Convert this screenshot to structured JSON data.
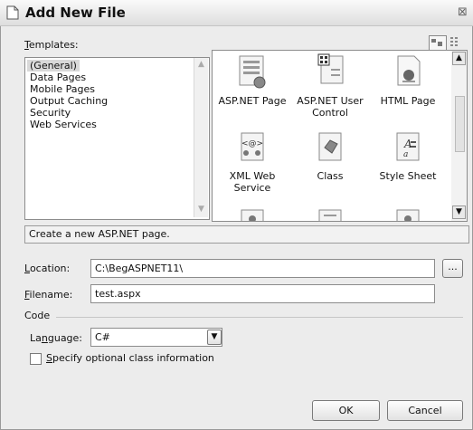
{
  "window": {
    "title": "Add New File",
    "close_glyph": "⊠"
  },
  "templates": {
    "label": "Templates:",
    "label_key": "T",
    "label_rest": "emplates:",
    "categories": [
      "(General)",
      "Data Pages",
      "Mobile Pages",
      "Output Caching",
      "Security",
      "Web Services"
    ],
    "selected_category": "(General)",
    "items": [
      {
        "caption": "ASP.NET Page",
        "icon": "aspnet-page-icon",
        "selected": true
      },
      {
        "caption": "ASP.NET User Control",
        "icon": "user-control-icon",
        "selected": false
      },
      {
        "caption": "HTML Page",
        "icon": "html-page-icon",
        "selected": false
      },
      {
        "caption": "XML Web Service",
        "icon": "xml-web-service-icon",
        "selected": false
      },
      {
        "caption": "Class",
        "icon": "class-icon",
        "selected": false
      },
      {
        "caption": "Style Sheet",
        "icon": "style-sheet-icon",
        "selected": false
      }
    ]
  },
  "description": "Create a new ASP.NET page.",
  "location": {
    "label_key": "L",
    "label_rest": "ocation:",
    "value": "C:\\BegASPNET11\\",
    "browse_label": "..."
  },
  "filename": {
    "label_key": "F",
    "label_rest": "ilename:",
    "value": "test.aspx"
  },
  "code": {
    "section_label": "Code",
    "language_label_pre": "La",
    "language_label_key": "n",
    "language_label_rest": "guage:",
    "language_value": "C#",
    "optional_key": "S",
    "optional_rest": "pecify optional class information",
    "optional_checked": false
  },
  "buttons": {
    "ok": "OK",
    "cancel": "Cancel"
  }
}
